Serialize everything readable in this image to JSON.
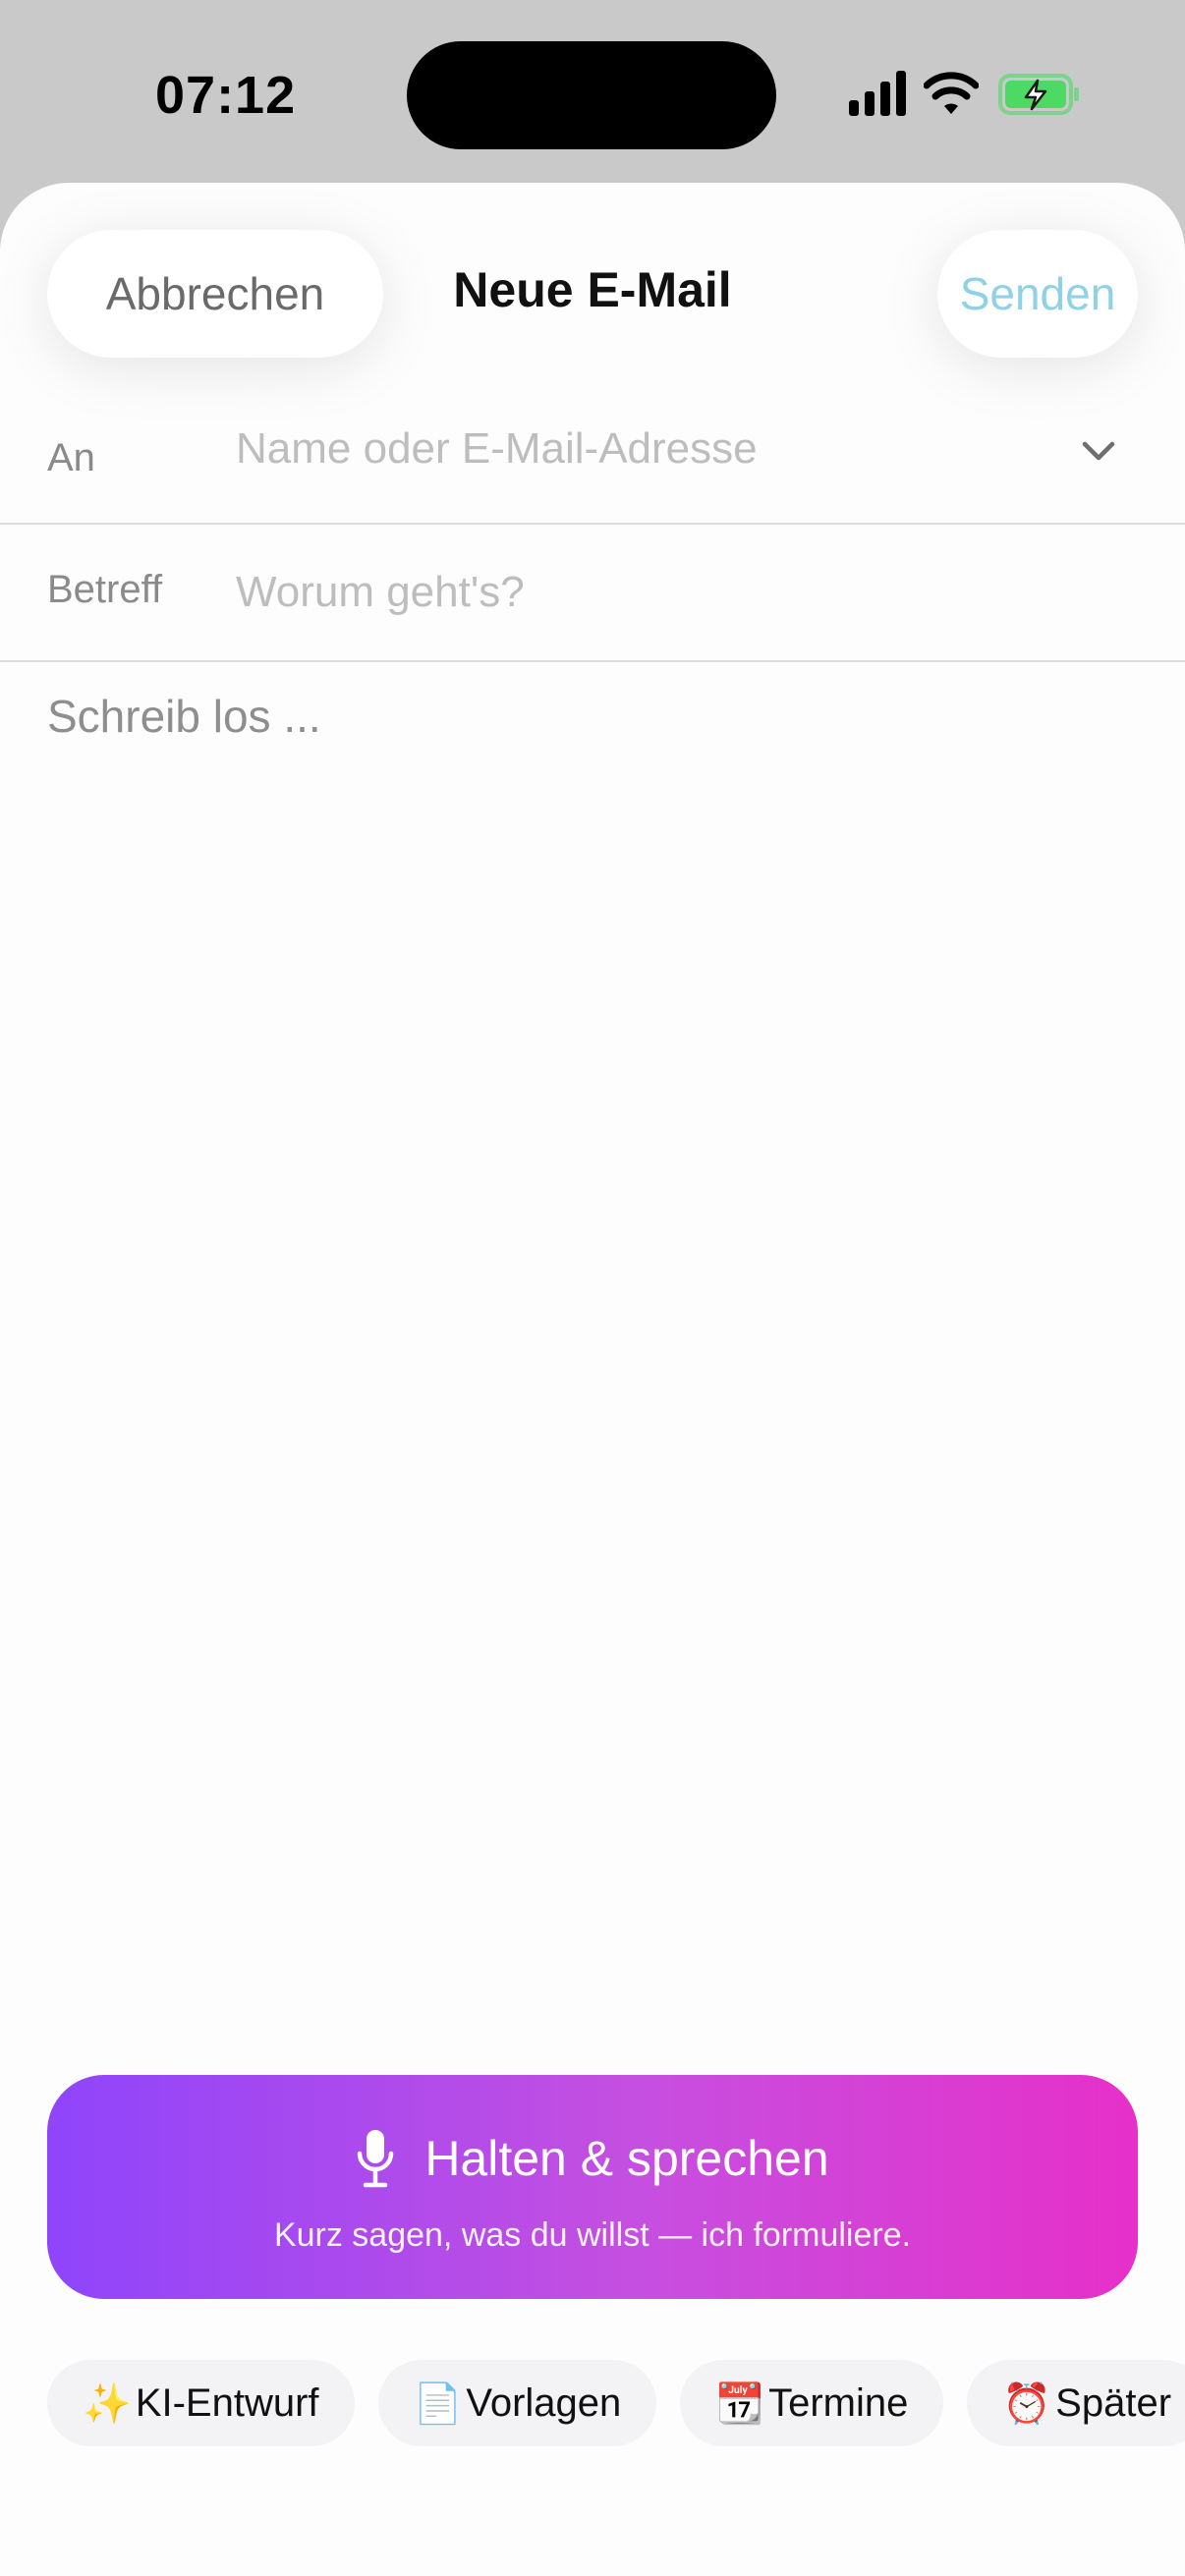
{
  "status_bar": {
    "time": "07:12",
    "icons": [
      "cellular-signal-icon",
      "wifi-icon",
      "battery-charging-icon"
    ],
    "battery_color": "#4cd964"
  },
  "header": {
    "cancel_label": "Abbrechen",
    "title": "Neue E-Mail",
    "send_label": "Senden",
    "send_color": "#8fd2e6"
  },
  "to_field": {
    "label": "An",
    "placeholder": "Name oder E-Mail-Adresse",
    "value": ""
  },
  "subject_field": {
    "label": "Betreff",
    "placeholder": "Worum geht's?",
    "value": ""
  },
  "body": {
    "placeholder": "Schreib los ...",
    "value": ""
  },
  "voice_button": {
    "title": "Halten & sprechen",
    "subtitle": "Kurz sagen, was du willst — ich formuliere.",
    "gradient": [
      "#8f45fb",
      "#e630c9"
    ]
  },
  "chips": [
    {
      "emoji": "✨",
      "label": "KI-Entwurf"
    },
    {
      "emoji": "📄",
      "label": "Vorlagen"
    },
    {
      "emoji": "📆",
      "label": "Termine"
    },
    {
      "emoji": "⏰",
      "label": "Später"
    }
  ]
}
